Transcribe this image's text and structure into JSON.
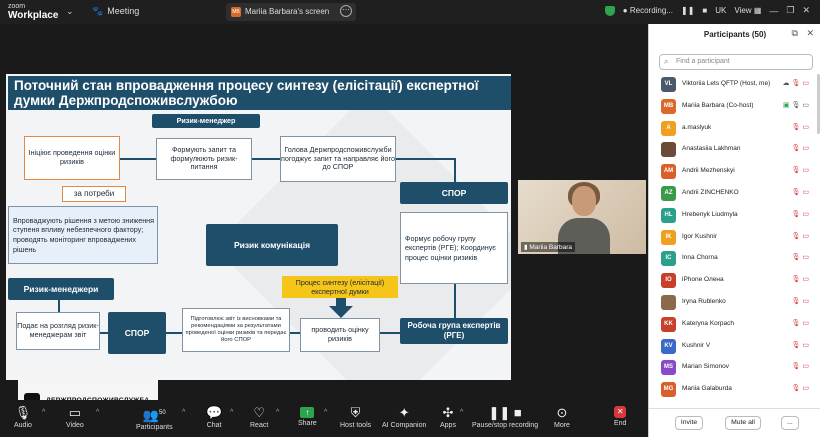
{
  "topbar": {
    "brand_top": "zoom",
    "brand_bottom": "Workplace",
    "meeting_label": "Meeting",
    "screen_badge": "MB",
    "screen_label": "Mariia Barbara's screen",
    "recording_label": "Recording...",
    "language": "UK",
    "view_label": "View"
  },
  "slide": {
    "title": "Поточний стан впровадження процесу синтезу (елісітації) експертної думки Держпродспоживслужбою",
    "risk_manager_top": "Ризик-менеджер",
    "initiate": "Ініціює проведення оцінки ризиків",
    "form_request": "Формують запит та формулюють ризик-питання",
    "head_agree": "Голова Держпродспоживслужби погоджує запит та направляє його до СПОР",
    "spor_right": "СПОР",
    "as_needed": "за потреби",
    "implement": "Впроваджують рішення з метою зниження ступеня впливу небезпечного фактору; проводять моніторинг впроваджених рішень",
    "risk_comm": "Ризик комунікація",
    "forms_group": "Формує робочу групу експертів (РГЕ); Координує процес оцінки ризиків",
    "risk_managers_left": "Ризик-менеджери",
    "synthesis_process": "Процес синтезу (елісітації) експертної думки",
    "submits": "Подає на розгляд ризик-менеджерам звіт",
    "spor_bottom": "СПОР",
    "prepares": "Підготовлює звіт із висновками та рекомендаціями за результатами проведеної оцінки ризиків та передає його СПОР",
    "conducts": "проводить оцінку ризиків",
    "work_group": "Робоча група експертів (РГЕ)"
  },
  "video": {
    "name": "Mariia Barbara"
  },
  "logo": {
    "text": "ДЕРЖПРОДСПОЖИВСЛУЖБА"
  },
  "toolbar": {
    "audio": "Audio",
    "video": "Video",
    "participants": "Participants",
    "participants_count": "50",
    "chat": "Chat",
    "react": "React",
    "share": "Share",
    "host_tools": "Host tools",
    "ai_companion": "AI Companion",
    "apps": "Apps",
    "pause_stop": "Pause/stop recording",
    "more": "More",
    "end": "End"
  },
  "panel": {
    "title": "Participants (50)",
    "search_placeholder": "Find a participant",
    "participants": [
      {
        "initials": "VL",
        "name": "Viktoriia Lets QFTP (Host, me)",
        "color": "#4a5a6a"
      },
      {
        "initials": "MB",
        "name": "Mariia Barbara (Co-host)",
        "color": "#d96a2c"
      },
      {
        "initials": "A",
        "name": "a.maslyuk",
        "color": "#f0a020"
      },
      {
        "initials": "",
        "name": "Anastasiia Lakhman",
        "color": "#6b4a3a"
      },
      {
        "initials": "AM",
        "name": "Andrii Mezhenskyi",
        "color": "#d9602c"
      },
      {
        "initials": "AZ",
        "name": "Andrii ZINCHENKO",
        "color": "#3a9a4a"
      },
      {
        "initials": "HL",
        "name": "Hrebenyk Liudmyla",
        "color": "#2aa08a"
      },
      {
        "initials": "IK",
        "name": "Igor Kushnir",
        "color": "#f0a020"
      },
      {
        "initials": "IC",
        "name": "Inna Chorna",
        "color": "#2aa08a"
      },
      {
        "initials": "IO",
        "name": "iPhone Олена",
        "color": "#c8402c"
      },
      {
        "initials": "",
        "name": "Iryna Rublenko",
        "color": "#8a6a4a"
      },
      {
        "initials": "KK",
        "name": "Kateryna Korpach",
        "color": "#c8402c"
      },
      {
        "initials": "KV",
        "name": "Kushnir V",
        "color": "#3a6ac8"
      },
      {
        "initials": "MS",
        "name": "Marian Simonov",
        "color": "#8a4ac8"
      },
      {
        "initials": "MG",
        "name": "Mariia Galaburda",
        "color": "#d9602c"
      }
    ],
    "invite_label": "Invite",
    "mute_all_label": "Mute all",
    "more_label": "..."
  }
}
